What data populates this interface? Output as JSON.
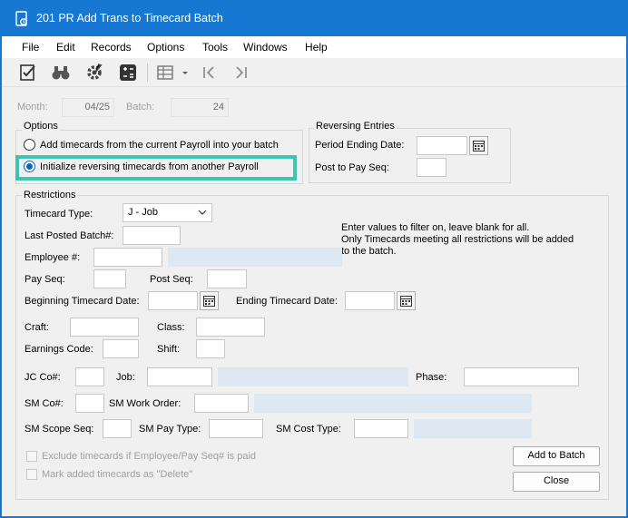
{
  "window": {
    "title": "201 PR Add Trans to Timecard Batch"
  },
  "menu": [
    "File",
    "Edit",
    "Records",
    "Options",
    "Tools",
    "Windows",
    "Help"
  ],
  "toolbar": {
    "icons": [
      "checklist-icon",
      "binoculars-icon",
      "settings-wrench-icon",
      "calculator-icon",
      "grid-view-icon",
      "dropdown-arrow-icon",
      "first-record-icon",
      "last-record-icon"
    ]
  },
  "header": {
    "month_label": "Month:",
    "month_value": "04/25",
    "batch_label": "Batch:",
    "batch_value": "24"
  },
  "options": {
    "title": "Options",
    "opt1": "Add timecards from the current Payroll into your batch",
    "opt2": "Initialize reversing timecards from another Payroll",
    "selected": 2
  },
  "reversing": {
    "title": "Reversing Entries",
    "period_label": "Period Ending Date:",
    "post_label": "Post to Pay Seq:"
  },
  "restrictions": {
    "title": "Restrictions",
    "timecard_type_label": "Timecard Type:",
    "timecard_type_value": "J - Job",
    "last_batch_label": "Last Posted Batch#:",
    "employee_label": "Employee #:",
    "payseq_label": "Pay Seq:",
    "postseq_label": "Post Seq:",
    "begin_date_label": "Beginning Timecard Date:",
    "end_date_label": "Ending Timecard Date:",
    "craft_label": "Craft:",
    "class_label": "Class:",
    "earnings_label": "Earnings Code:",
    "shift_label": "Shift:",
    "jcco_label": "JC Co#:",
    "job_label": "Job:",
    "phase_label": "Phase:",
    "smco_label": "SM Co#:",
    "smwo_label": "SM Work Order:",
    "smscope_label": "SM Scope Seq:",
    "smpay_label": "SM Pay Type:",
    "smcost_label": "SM Cost Type:",
    "info_line1": "Enter values to filter on, leave blank for all.",
    "info_line2": "Only Timecards meeting all restrictions will be added",
    "info_line3": "to the batch.",
    "exclude_label": "Exclude timecards if Employee/Pay Seq# is paid",
    "mark_label": "Mark added timecards as \"Delete\""
  },
  "buttons": {
    "add": "Add to Batch",
    "close": "Close"
  },
  "colors": {
    "title_bar": "#1778d4",
    "highlight": "#3cc3b4",
    "info_field": "#dde8f2"
  }
}
